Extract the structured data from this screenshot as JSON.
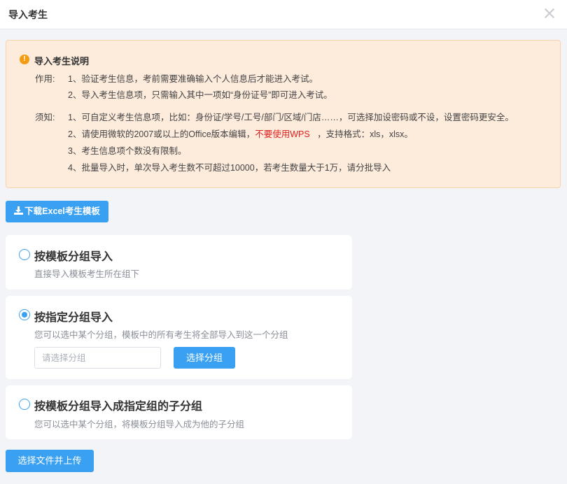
{
  "dialog": {
    "title": "导入考生",
    "close_icon": "close-icon"
  },
  "notice": {
    "icon": "warning-icon",
    "heading": "导入考生说明",
    "purpose_label": "作用:",
    "purpose_lines": [
      "1、验证考生信息，考前需要准确输入个人信息后才能进入考试。",
      "2、导入考生信息项，只需输入其中一项如“身份证号”即可进入考试。"
    ],
    "note_label": "须知:",
    "note_lines": [
      "1、可自定义考生信息项，比如：身份证/学号/工号/部门/区域/门店……，可选择加设密码或不设，设置密码更安全。",
      "2、请使用微软的2007或以上的Office版本编辑，",
      "3、考生信息项个数没有限制。",
      "4、批量导入时，单次导入考生数不可超过10000，若考生数量大于1万，请分批导入"
    ],
    "note_warning": "不要使用WPS",
    "note_formats": "，支持格式：xls，xlsx。"
  },
  "download_button": {
    "label": "下载Excel考生模板",
    "icon": "download-icon"
  },
  "options": [
    {
      "title": "按模板分组导入",
      "desc": "直接导入模板考生所在组下",
      "checked": false
    },
    {
      "title": "按指定分组导入",
      "desc": "您可以选中某个分组，模板中的所有考生将全部导入到这一个分组",
      "checked": true,
      "input_placeholder": "请选择分组",
      "choose_label": "选择分组"
    },
    {
      "title": "按模板分组导入成指定组的子分组",
      "desc": "您可以选中某个分组，将模板分组导入成为他的子分组",
      "checked": false
    }
  ],
  "upload_button": {
    "label": "选择文件并上传"
  },
  "colors": {
    "accent": "#3aa1f2",
    "notice_bg": "#fdebdc",
    "warning_text": "#e02020",
    "warning_icon": "#f39c12"
  }
}
